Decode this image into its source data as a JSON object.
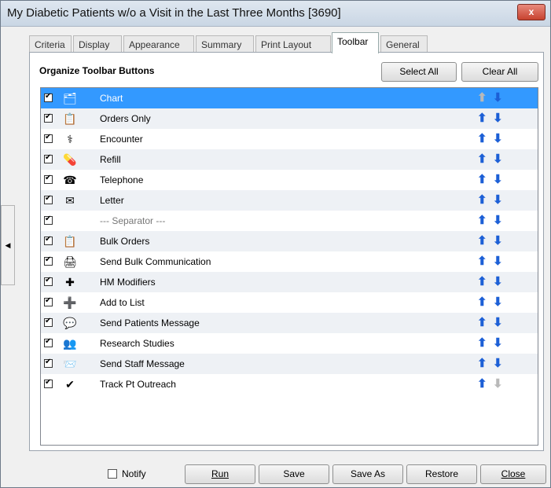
{
  "window": {
    "title": "My Diabetic Patients w/o a Visit in the Last Three Months [3690]",
    "close_label": "x"
  },
  "tabs": [
    {
      "label": "Criteria",
      "active": false
    },
    {
      "label": "Display",
      "active": false
    },
    {
      "label": "Appearance",
      "active": false
    },
    {
      "label": "Summary",
      "active": false
    },
    {
      "label": "Print Layout",
      "active": false
    },
    {
      "label": "Toolbar",
      "active": true
    },
    {
      "label": "General",
      "active": false
    }
  ],
  "panel": {
    "title": "Organize Toolbar Buttons",
    "select_all": "Select All",
    "clear_all": "Clear All"
  },
  "items": [
    {
      "label": "Chart",
      "icon": "chart-icon",
      "glyph": "🗂",
      "checked": true,
      "selected": true,
      "up_enabled": false,
      "down_enabled": true
    },
    {
      "label": "Orders Only",
      "icon": "orders-clipboard-icon",
      "glyph": "📋",
      "checked": true,
      "selected": false,
      "up_enabled": true,
      "down_enabled": true
    },
    {
      "label": "Encounter",
      "icon": "stethoscope-icon",
      "glyph": "⚕",
      "checked": true,
      "selected": false,
      "up_enabled": true,
      "down_enabled": true
    },
    {
      "label": "Refill",
      "icon": "refill-icon",
      "glyph": "💊",
      "checked": true,
      "selected": false,
      "up_enabled": true,
      "down_enabled": true
    },
    {
      "label": "Telephone",
      "icon": "telephone-icon",
      "glyph": "☎",
      "checked": true,
      "selected": false,
      "up_enabled": true,
      "down_enabled": true
    },
    {
      "label": "Letter",
      "icon": "letter-icon",
      "glyph": "✉",
      "checked": true,
      "selected": false,
      "up_enabled": true,
      "down_enabled": true
    },
    {
      "label": "--- Separator ---",
      "icon": "",
      "glyph": "",
      "checked": true,
      "selected": false,
      "separator": true,
      "up_enabled": true,
      "down_enabled": true
    },
    {
      "label": "Bulk Orders",
      "icon": "bulk-orders-icon",
      "glyph": "📋",
      "checked": true,
      "selected": false,
      "up_enabled": true,
      "down_enabled": true
    },
    {
      "label": "Send Bulk Communication",
      "icon": "bulk-communication-icon",
      "glyph": "🖨",
      "checked": true,
      "selected": false,
      "up_enabled": true,
      "down_enabled": true
    },
    {
      "label": "HM Modifiers",
      "icon": "hm-modifiers-icon",
      "glyph": "✚",
      "checked": true,
      "selected": false,
      "up_enabled": true,
      "down_enabled": true
    },
    {
      "label": "Add to List",
      "icon": "add-to-list-icon",
      "glyph": "➕",
      "checked": true,
      "selected": false,
      "up_enabled": true,
      "down_enabled": true
    },
    {
      "label": "Send Patients Message",
      "icon": "patients-message-icon",
      "glyph": "💬",
      "checked": true,
      "selected": false,
      "up_enabled": true,
      "down_enabled": true
    },
    {
      "label": "Research Studies",
      "icon": "research-studies-icon",
      "glyph": "👥",
      "checked": true,
      "selected": false,
      "up_enabled": true,
      "down_enabled": true
    },
    {
      "label": "Send Staff Message",
      "icon": "staff-message-icon",
      "glyph": "📨",
      "checked": true,
      "selected": false,
      "up_enabled": true,
      "down_enabled": true
    },
    {
      "label": "Track Pt Outreach",
      "icon": "track-outreach-icon",
      "glyph": "✔",
      "checked": true,
      "selected": false,
      "up_enabled": true,
      "down_enabled": false
    }
  ],
  "footer": {
    "notify": "Notify",
    "run": "Run",
    "save": "Save",
    "save_as": "Save As",
    "restore": "Restore",
    "close": "Close"
  },
  "colors": {
    "selection": "#3399ff",
    "arrow": "#1c5fd6"
  }
}
